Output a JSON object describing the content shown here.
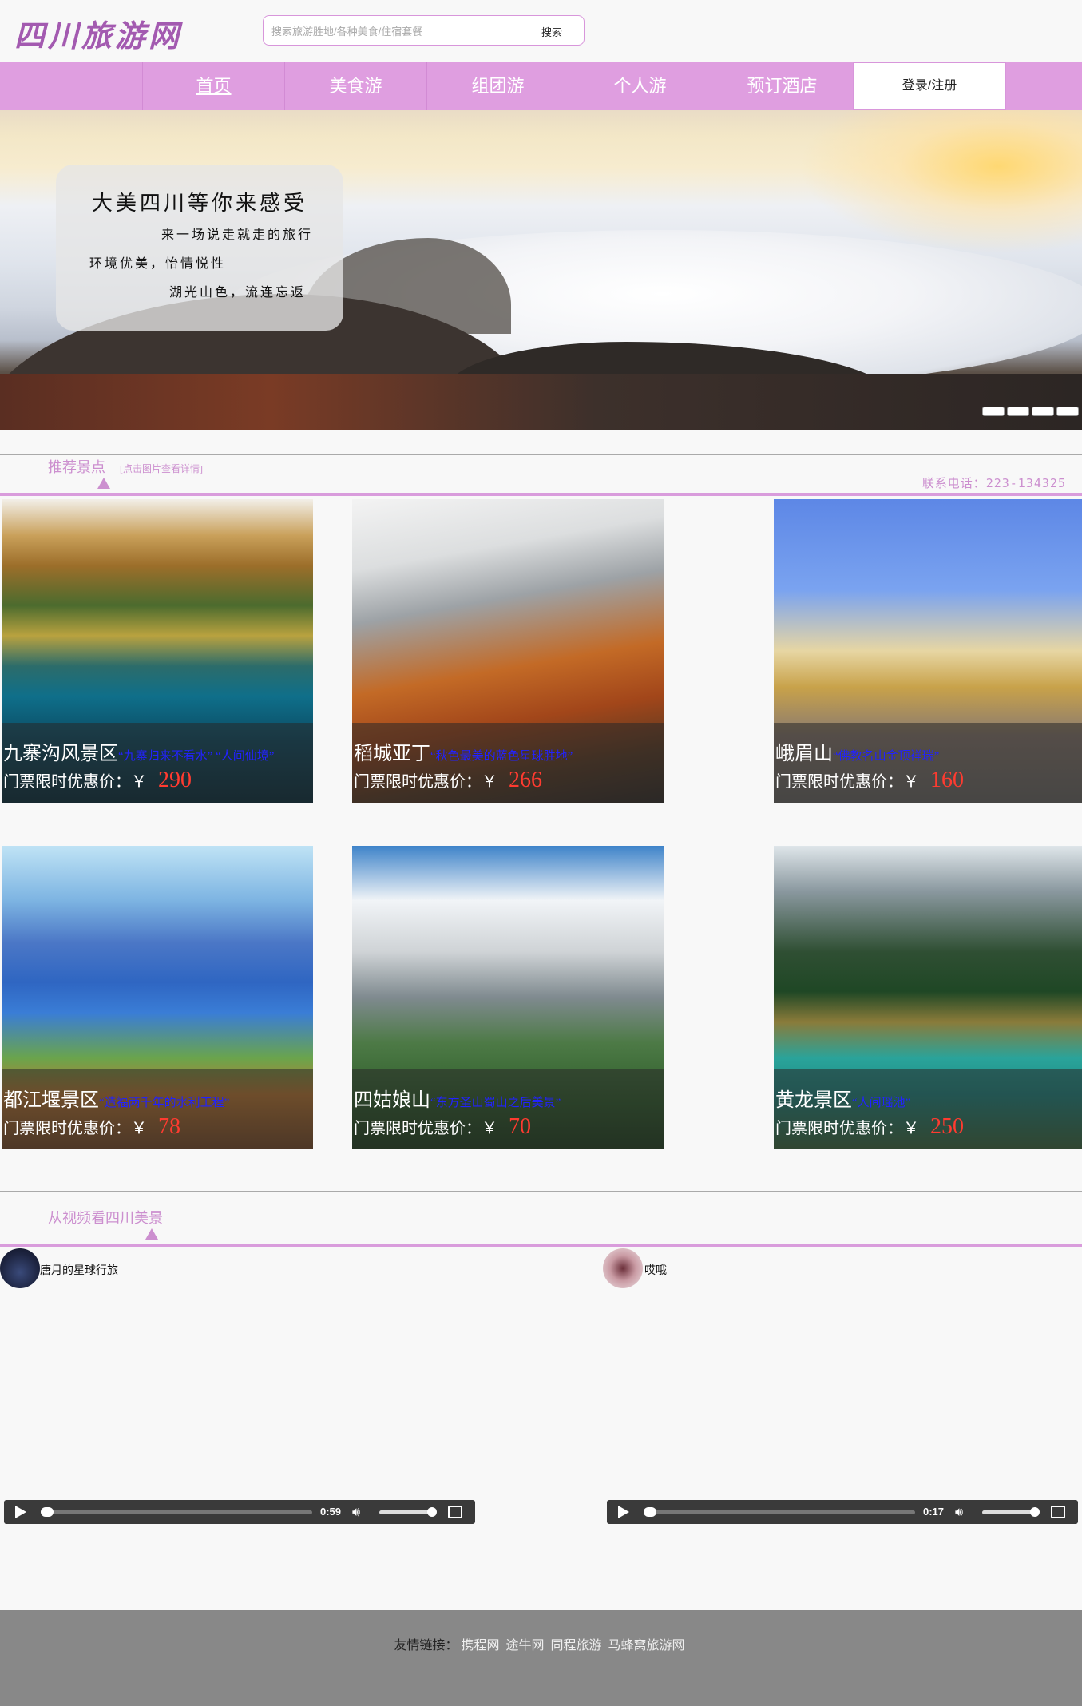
{
  "header": {
    "logo": "四川旅游网",
    "search_placeholder": "搜索旅游胜地/各种美食/住宿套餐",
    "search_button": "搜索"
  },
  "nav": {
    "items": [
      {
        "label": "首页",
        "active": true
      },
      {
        "label": "美食游",
        "active": false
      },
      {
        "label": "组团游",
        "active": false
      },
      {
        "label": "个人游",
        "active": false
      },
      {
        "label": "预订酒店",
        "active": false
      }
    ],
    "login": "登录/注册"
  },
  "banner": {
    "title": "大美四川等你来感受",
    "line1": "来一场说走就走的旅行",
    "line2": "环境优美，怡情悦性",
    "line3": "湖光山色，流连忘返",
    "slide_count": 4
  },
  "recommend": {
    "title": "推荐景点",
    "hint": "[点击图片查看详情]",
    "phone": "联系电话：223-134325",
    "price_label": "门票限时优惠价：￥",
    "spots": [
      {
        "name": "九寨沟风景区",
        "slogan": "“九寨归来不看水” “人间仙境”",
        "price": "290"
      },
      {
        "name": "稻城亚丁",
        "slogan": "“秋色最美的蓝色星球胜地”",
        "price": "266"
      },
      {
        "name": "峨眉山",
        "slogan": "“佛教名山金顶祥瑞”",
        "price": "160"
      },
      {
        "name": "都江堰景区",
        "slogan": "“造福两千年的水利工程”",
        "price": "78"
      },
      {
        "name": "四姑娘山",
        "slogan": "“东方圣山蜀山之后美景”",
        "price": "70"
      },
      {
        "name": "黄龙景区",
        "slogan": "“人间瑶池”",
        "price": "250"
      }
    ]
  },
  "videos": {
    "title": "从视频看四川美景",
    "items": [
      {
        "author": "唐月的星球行旅",
        "time": "0:59"
      },
      {
        "author": "哎哦",
        "time": "0:17"
      }
    ]
  },
  "footer": {
    "label": "友情链接：",
    "links": [
      "携程网",
      "途牛网",
      "同程旅游",
      "马蜂窝旅游网"
    ]
  }
}
